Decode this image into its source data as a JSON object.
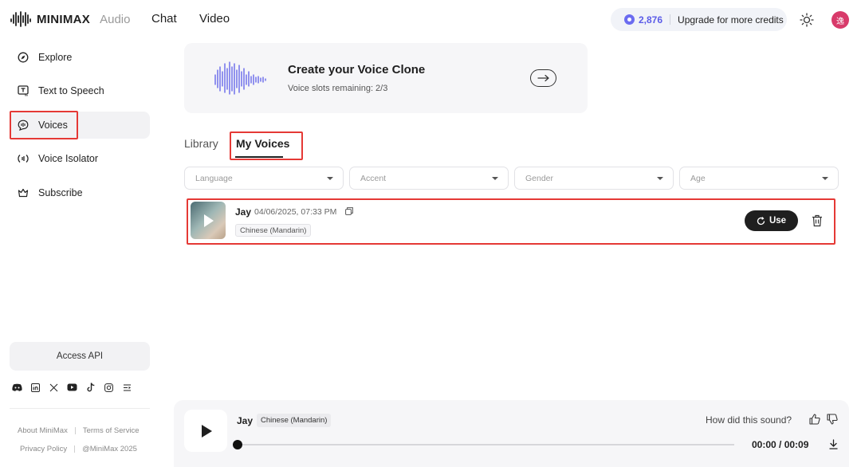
{
  "brand": {
    "name": "MINIMAX",
    "product": "Audio"
  },
  "nav": {
    "chat": "Chat",
    "video": "Video"
  },
  "credits": {
    "amount": "2,876",
    "upgrade_label": "Upgrade for more credits"
  },
  "user": {
    "avatar_initial": "逸"
  },
  "sidebar": {
    "items": [
      {
        "label": "Explore",
        "icon": "compass-icon"
      },
      {
        "label": "Text to Speech",
        "icon": "text-to-speech-icon"
      },
      {
        "label": "Voices",
        "icon": "voices-icon",
        "active": true
      },
      {
        "label": "Voice Isolator",
        "icon": "voice-isolator-icon"
      },
      {
        "label": "Subscribe",
        "icon": "crown-icon"
      }
    ],
    "access_api": "Access API",
    "socials": [
      "discord-icon",
      "linkedin-icon",
      "x-icon",
      "youtube-icon",
      "tiktok-icon",
      "instagram-icon",
      "more-icon"
    ],
    "footer": {
      "about": "About MiniMax",
      "terms": "Terms of Service",
      "privacy": "Privacy Policy",
      "copyright": "@MiniMax 2025"
    }
  },
  "clone_card": {
    "title": "Create your Voice Clone",
    "subtitle": "Voice slots remaining: 2/3"
  },
  "tabs": {
    "library": "Library",
    "my_voices": "My Voices"
  },
  "filters": {
    "language": "Language",
    "accent": "Accent",
    "gender": "Gender",
    "age": "Age"
  },
  "voice": {
    "name": "Jay",
    "date": "04/06/2025, 07:33 PM",
    "tag": "Chinese (Mandarin)",
    "use_label": "Use"
  },
  "player": {
    "name": "Jay",
    "tag": "Chinese (Mandarin)",
    "feedback": "How did this sound?",
    "time": "00:00 / 00:09",
    "progress": 0
  },
  "colors": {
    "accent": "#5b5ce8",
    "highlight": "#e53935",
    "avatar": "#d83a6a"
  }
}
